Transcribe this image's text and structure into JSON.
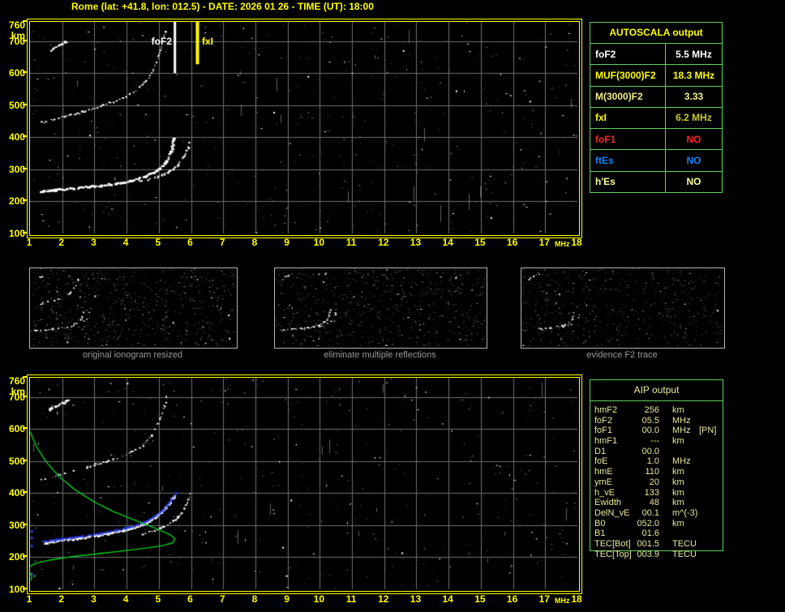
{
  "title": "Rome (lat: +41.8, lon: 012.5) - DATE: 2026 01 26 - TIME (UT): 18:00",
  "colors": {
    "background": "#000000",
    "accent_yellow": "#ffff00",
    "grid": "#707070",
    "table_border_green": "#5fce5f",
    "aip_text": "#e8e89a",
    "profile_green": "#00cc22",
    "restored_trace_blue": "#3344ff",
    "panel_label_gray": "#9a9a9a"
  },
  "autoscala_table": {
    "title": "AUTOSCALA output",
    "rows": [
      {
        "label": "foF2",
        "value": "5.5 MHz",
        "label_color": "#ffffff",
        "value_color": "#ffffff"
      },
      {
        "label": "MUF(3000)F2",
        "value": "18.3 MHz",
        "label_color": "#ffff00",
        "value_color": "#ffff00"
      },
      {
        "label": "M(3000)F2",
        "value": "3.33",
        "label_color": "#eeee88",
        "value_color": "#eeee88"
      },
      {
        "label": "fxI",
        "value": "6.2 MHz",
        "label_color": "#ffff00",
        "value_color": "#c8c832"
      },
      {
        "label": "foF1",
        "value": "NO",
        "label_color": "#ff2222",
        "value_color": "#ff2222"
      },
      {
        "label": "ftEs",
        "value": "NO",
        "label_color": "#0b84ff",
        "value_color": "#0b84ff"
      },
      {
        "label": "h'Es",
        "value": "NO",
        "label_color": "#ffff99",
        "value_color": "#ffff99"
      }
    ]
  },
  "aip_table": {
    "title": "AIP output",
    "rows": [
      {
        "label": "hmF2",
        "value": "256",
        "unit": "km",
        "note": ""
      },
      {
        "label": "foF2",
        "value": "05.5",
        "unit": "MHz",
        "note": ""
      },
      {
        "label": "foF1",
        "value": "00.0",
        "unit": "MHz",
        "note": "[PN]"
      },
      {
        "label": "hmF1",
        "value": "---",
        "unit": "km",
        "note": ""
      },
      {
        "label": "D1",
        "value": "00.0",
        "unit": "",
        "note": ""
      },
      {
        "label": "foE",
        "value": "1.0",
        "unit": "MHz",
        "note": ""
      },
      {
        "label": "hmE",
        "value": "110",
        "unit": "km",
        "note": ""
      },
      {
        "label": "ymE",
        "value": "20",
        "unit": "km",
        "note": ""
      },
      {
        "label": "h_vE",
        "value": "133",
        "unit": "km",
        "note": ""
      },
      {
        "label": "Ewidth",
        "value": "48",
        "unit": "km",
        "note": ""
      },
      {
        "label": "DelN_vE",
        "value": "00.1",
        "unit": "m^(-3)",
        "note": ""
      },
      {
        "label": "B0",
        "value": "052.0",
        "unit": "km",
        "note": ""
      },
      {
        "label": "B1",
        "value": "01.6",
        "unit": "",
        "note": ""
      },
      {
        "label": "TEC[Bot]",
        "value": "001.5",
        "unit": "TECU",
        "note": ""
      },
      {
        "label": "TEC[Top]",
        "value": "003.9",
        "unit": "TECU",
        "note": ""
      }
    ]
  },
  "chart_data": [
    {
      "id": "scaled_ionogram",
      "type": "scatter",
      "title": "scaled ionogram with foF2 and fxI markers",
      "xlabel": "MHz",
      "ylabel": "km",
      "x_range": [
        1,
        18
      ],
      "x_ticks": [
        1,
        2,
        3,
        4,
        5,
        6,
        7,
        8,
        9,
        10,
        11,
        12,
        13,
        14,
        15,
        16,
        17,
        18
      ],
      "y_range": [
        100,
        760
      ],
      "y_tick_labels": [
        760,
        700,
        600,
        500,
        400,
        300,
        200,
        100
      ],
      "y_gridlines": [
        700,
        600,
        500,
        400,
        300,
        200
      ],
      "grid": true,
      "legend": "none",
      "markers": [
        {
          "name": "foF2",
          "freq": 5.5,
          "to_km": 600,
          "width": 3,
          "color": "#ffffff"
        },
        {
          "name": "fxI",
          "freq": 6.2,
          "to_km": 628,
          "width": 4,
          "color": "#ffff00"
        }
      ],
      "noise": {
        "seed": 11,
        "gray": 330,
        "white": 130,
        "streaks": 16
      },
      "traces": [
        {
          "name": "F2-trace-ordinary",
          "color": "#ffffff",
          "style": "blob",
          "thickness": 3.2,
          "dropout": 0.1,
          "points": [
            [
              1.35,
              229
            ],
            [
              2.34,
              239
            ],
            [
              3.35,
              249
            ],
            [
              4.1,
              262
            ],
            [
              4.61,
              277
            ],
            [
              4.98,
              297
            ],
            [
              5.24,
              322
            ],
            [
              5.39,
              353
            ],
            [
              5.46,
              386
            ],
            [
              5.5,
              400
            ]
          ]
        },
        {
          "name": "F2-trace-extraordinary",
          "color": "#ffffff",
          "style": "blob",
          "thickness": 2.2,
          "dropout": 0.3,
          "points": [
            [
              4.4,
              262
            ],
            [
              4.9,
              273
            ],
            [
              5.3,
              290
            ],
            [
              5.6,
              313
            ],
            [
              5.8,
              340
            ],
            [
              5.92,
              368
            ],
            [
              5.97,
              390
            ]
          ]
        },
        {
          "name": "second-hop-multiple",
          "color": "#ffffff",
          "style": "blob",
          "thickness": 2,
          "dropout": 0.45,
          "points": [
            [
              1.33,
              444
            ],
            [
              2.0,
              462
            ],
            [
              2.7,
              480
            ],
            [
              3.4,
              503
            ],
            [
              3.9,
              522
            ],
            [
              4.3,
              546
            ],
            [
              4.6,
              574
            ],
            [
              4.85,
              610
            ],
            [
              5.0,
              650
            ],
            [
              5.1,
              688
            ],
            [
              5.2,
              730
            ]
          ]
        },
        {
          "name": "high-altitude-echo",
          "color": "#ffffff",
          "style": "blob",
          "thickness": 3,
          "dropout": 0.12,
          "points": [
            [
              1.6,
              668
            ],
            [
              2.2,
              700
            ]
          ]
        }
      ]
    },
    {
      "id": "processing_steps",
      "type": "image-row",
      "panels": [
        {
          "label": "original ionogram resized",
          "noise": {
            "seed": 31,
            "gray": 540,
            "white": 40,
            "streaks": 0
          },
          "trace_refs": [
            {
              "trace": 0,
              "dropout_add": 0.2
            },
            {
              "trace": 1,
              "dropout_add": 0.3
            },
            {
              "trace": 2,
              "dropout_add": 0.25
            },
            {
              "trace": 3,
              "dropout_add": 0.15
            }
          ]
        },
        {
          "label": "eliminate multiple reflections",
          "noise": {
            "seed": 32,
            "gray": 520,
            "white": 35,
            "streaks": 0
          },
          "trace_refs": [
            {
              "trace": 0,
              "dropout_add": 0.25
            },
            {
              "trace": 1,
              "dropout_add": 0.35
            },
            {
              "trace": 2,
              "dropout_add": 0.35,
              "fmin": 4.0
            },
            {
              "trace": 3,
              "dropout_add": 0.15
            }
          ]
        },
        {
          "label": "evidence F2 trace",
          "noise": {
            "seed": 33,
            "gray": 430,
            "white": 18,
            "streaks": 0
          },
          "trace_refs": [
            {
              "trace": 0,
              "dropout_add": 0.45
            },
            {
              "trace": 1,
              "dropout_add": 0.5
            },
            {
              "trace": 2,
              "dropout_add": 0.5,
              "fmin": 3.5
            },
            {
              "trace": 3,
              "dropout_add": 0.3
            }
          ]
        }
      ]
    },
    {
      "id": "profile_ionogram",
      "type": "scatter",
      "title": "restored trace and electron density profile",
      "xlabel": "MHz",
      "ylabel": "km",
      "x_range": [
        1,
        18
      ],
      "x_ticks": [
        1,
        2,
        3,
        4,
        5,
        6,
        7,
        8,
        9,
        10,
        11,
        12,
        13,
        14,
        15,
        16,
        17,
        18
      ],
      "y_range": [
        100,
        760
      ],
      "y_tick_labels": [
        760,
        700,
        600,
        500,
        400,
        300,
        200,
        100
      ],
      "y_gridlines": [
        700,
        600,
        500,
        400,
        300,
        200
      ],
      "grid": true,
      "legend": "none",
      "markers": [],
      "noise": {
        "seed": 23,
        "gray": 330,
        "white": 115,
        "streaks": 14
      },
      "traces": [
        {
          "name": "F2-trace-ordinary",
          "color": "#ffffff",
          "style": "blob",
          "thickness": 3,
          "dropout": 0.12,
          "points": [
            [
              1.4,
              242
            ],
            [
              2.0,
              250
            ],
            [
              2.6,
              258
            ],
            [
              3.2,
              267
            ],
            [
              3.7,
              277
            ],
            [
              4.2,
              289
            ],
            [
              4.6,
              304
            ],
            [
              4.9,
              322
            ],
            [
              5.15,
              342
            ],
            [
              5.35,
              366
            ],
            [
              5.48,
              392
            ]
          ]
        },
        {
          "name": "F2-trace-extraordinary",
          "color": "#ffffff",
          "style": "blob",
          "thickness": 2.2,
          "dropout": 0.3,
          "points": [
            [
              4.5,
              272
            ],
            [
              4.9,
              283
            ],
            [
              5.3,
              300
            ],
            [
              5.6,
              323
            ],
            [
              5.8,
              350
            ],
            [
              5.93,
              378
            ],
            [
              5.98,
              396
            ]
          ]
        },
        {
          "name": "second-hop-multiple",
          "color": "#ffffff",
          "style": "blob",
          "thickness": 2,
          "dropout": 0.5,
          "points": [
            [
              1.33,
              440
            ],
            [
              2.1,
              462
            ],
            [
              2.9,
              484
            ],
            [
              3.6,
              505
            ],
            [
              4.1,
              524
            ],
            [
              4.5,
              548
            ],
            [
              4.8,
              580
            ],
            [
              5.0,
              618
            ],
            [
              5.15,
              658
            ],
            [
              5.25,
              700
            ]
          ]
        },
        {
          "name": "high-altitude-echo",
          "color": "#ffffff",
          "style": "blob",
          "thickness": 3,
          "dropout": 0.12,
          "points": [
            [
              1.6,
              658
            ],
            [
              2.2,
              688
            ]
          ]
        },
        {
          "name": "restored-trace",
          "color": "#3344ff",
          "style": "plus",
          "thickness": 1,
          "dropout": 0.1,
          "points": [
            [
              1.4,
              250
            ],
            [
              2.0,
              258
            ],
            [
              2.6,
              266
            ],
            [
              3.2,
              275
            ],
            [
              3.7,
              285
            ],
            [
              4.2,
              297
            ],
            [
              4.6,
              312
            ],
            [
              4.9,
              330
            ],
            [
              5.15,
              350
            ],
            [
              5.33,
              372
            ],
            [
              5.45,
              390
            ]
          ]
        },
        {
          "name": "restored-trace-isolated-points",
          "color": "#3344ff",
          "style": "plus-points",
          "thickness": 1,
          "dropout": 0,
          "points": [
            [
              1.04,
              282
            ],
            [
              1.04,
              262
            ],
            [
              1.04,
              236
            ],
            [
              1.04,
              148
            ],
            [
              5.52,
              400
            ]
          ]
        },
        {
          "name": "electron-density-profile",
          "color": "#00cc22",
          "style": "line",
          "thickness": 1.4,
          "dropout": 0,
          "points": [
            [
              1.0,
              592
            ],
            [
              1.2,
              545
            ],
            [
              1.5,
              498
            ],
            [
              1.9,
              452
            ],
            [
              2.4,
              410
            ],
            [
              3.0,
              372
            ],
            [
              3.6,
              342
            ],
            [
              4.2,
              318
            ],
            [
              4.7,
              298
            ],
            [
              5.1,
              282
            ],
            [
              5.35,
              270
            ],
            [
              5.5,
              258
            ],
            [
              5.45,
              246
            ],
            [
              5.2,
              238
            ],
            [
              4.7,
              230
            ],
            [
              4.0,
              221
            ],
            [
              3.2,
              212
            ],
            [
              2.4,
              203
            ],
            [
              1.7,
              193
            ],
            [
              1.2,
              182
            ],
            [
              1.0,
              172
            ]
          ]
        },
        {
          "name": "electron-density-profile-E-region",
          "color": "#00cc22",
          "style": "line",
          "thickness": 1.4,
          "dropout": 0,
          "points": [
            [
              1.0,
              152
            ],
            [
              1.06,
              140
            ],
            [
              1.02,
              128
            ]
          ]
        }
      ]
    }
  ]
}
